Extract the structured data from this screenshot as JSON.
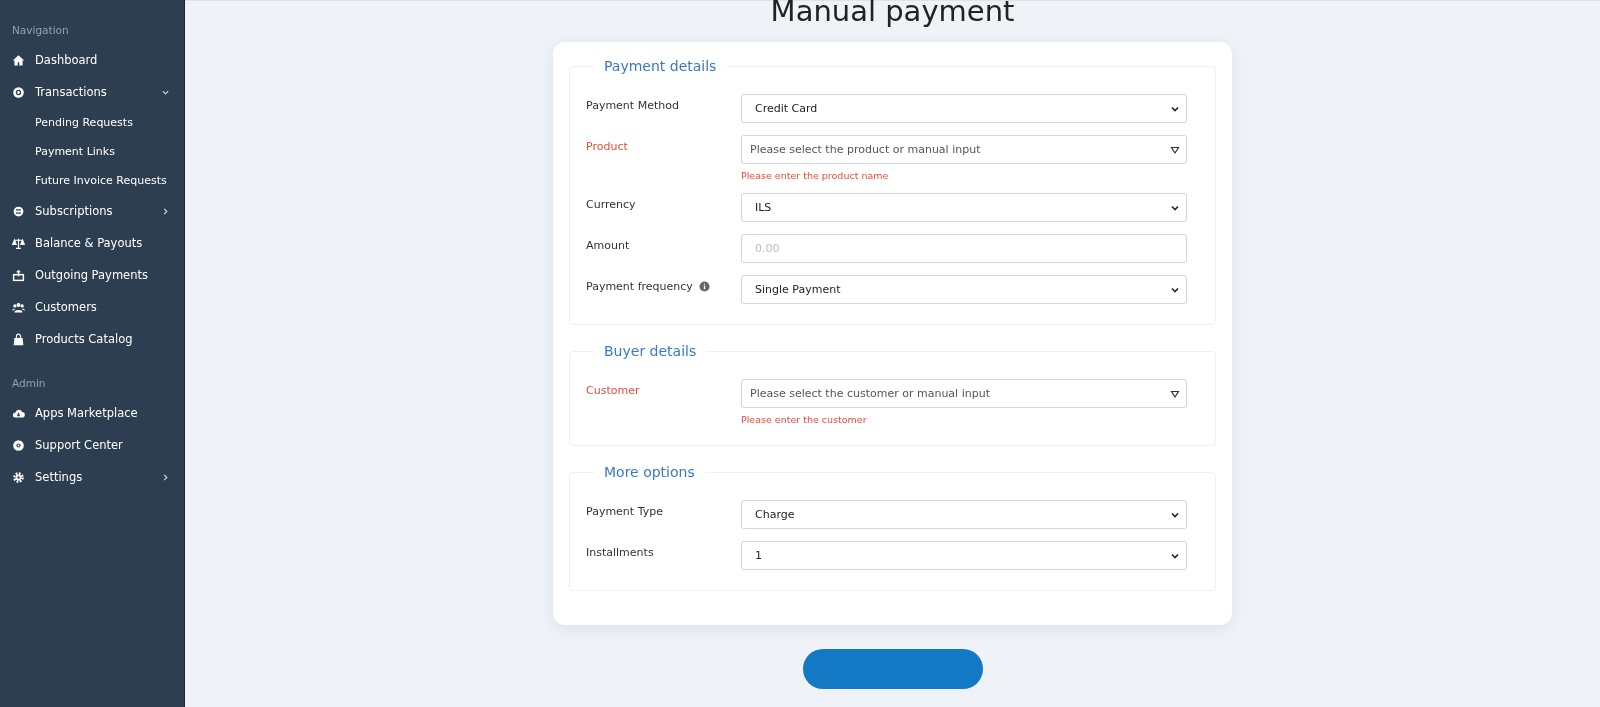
{
  "sidebar": {
    "sections": [
      {
        "heading": "Navigation",
        "items": [
          {
            "label": "Dashboard"
          },
          {
            "label": "Transactions",
            "expanded": true,
            "children": [
              {
                "label": "Pending Requests"
              },
              {
                "label": "Payment Links"
              },
              {
                "label": "Future Invoice Requests"
              }
            ]
          },
          {
            "label": "Subscriptions",
            "expanded": false
          },
          {
            "label": "Balance & Payouts"
          },
          {
            "label": "Outgoing Payments"
          },
          {
            "label": "Customers"
          },
          {
            "label": "Products Catalog"
          }
        ]
      },
      {
        "heading": "Admin",
        "items": [
          {
            "label": "Apps Marketplace"
          },
          {
            "label": "Support Center"
          },
          {
            "label": "Settings",
            "expanded": false
          }
        ]
      }
    ]
  },
  "page_title": "Manual payment",
  "sections": [
    {
      "title": "Payment details",
      "fields": [
        {
          "label": "Payment Method",
          "kind": "select",
          "value": "Credit Card"
        },
        {
          "label": "Product",
          "kind": "combo",
          "placeholder": "Please select the product or manual input",
          "error": "Please enter the product name"
        },
        {
          "label": "Currency",
          "kind": "select",
          "value": "ILS"
        },
        {
          "label": "Amount",
          "kind": "input",
          "placeholder": "0.00"
        },
        {
          "label": "Payment frequency",
          "kind": "select",
          "value": "Single Payment",
          "info": true
        }
      ]
    },
    {
      "title": "Buyer details",
      "fields": [
        {
          "label": "Customer",
          "kind": "combo",
          "placeholder": "Please select the customer or manual input",
          "error": "Please enter the customer"
        }
      ]
    },
    {
      "title": "More options",
      "fields": [
        {
          "label": "Payment Type",
          "kind": "select",
          "value": "Charge"
        },
        {
          "label": "Installments",
          "kind": "select",
          "value": "1"
        }
      ]
    }
  ]
}
